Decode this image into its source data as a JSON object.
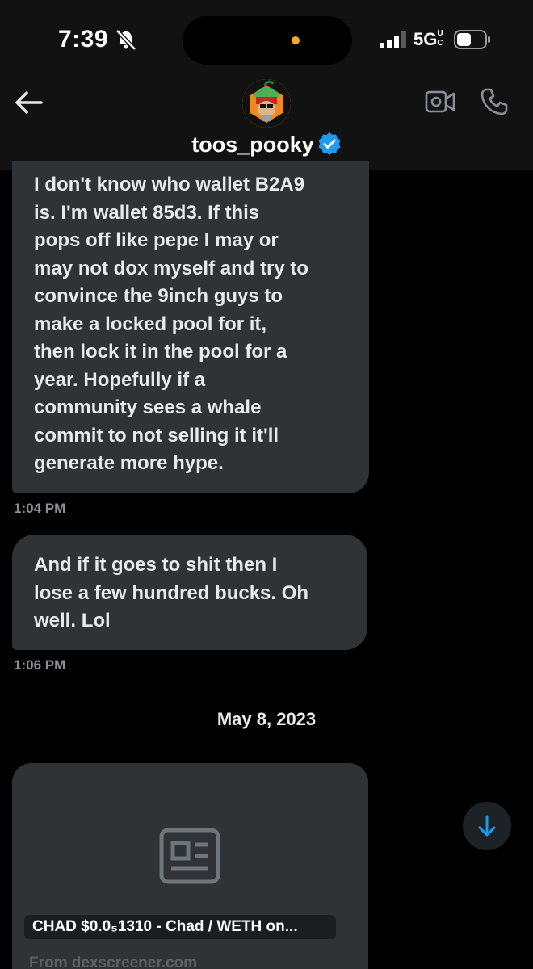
{
  "status_bar": {
    "time": "7:39",
    "bell_icon": "bell-slash-icon",
    "network": "5G",
    "network_suffix": "UC",
    "orange_indicator_color": "#f5a623"
  },
  "header": {
    "back_icon": "arrow-left-icon",
    "username": "toos_pooky",
    "verified_icon": "verified-badge-icon",
    "video_icon": "video-camera-icon",
    "phone_icon": "phone-icon",
    "avatar_color": "#f08a1d"
  },
  "messages": [
    {
      "text": "I don't know who wallet B2A9\nis. I'm wallet 85d3. If this\npops off like pepe I may or\nmay not dox myself and try to\nconvince the 9inch guys to\nmake a locked pool for it,\nthen lock it in the pool for a\nyear. Hopefully if a\ncommunity sees a whale\ncommit to not selling it it'll\ngenerate more hype.",
      "time": "1:04 PM"
    },
    {
      "text": "And if it goes to shit then I\nlose a few hundred bucks. Oh\nwell. Lol",
      "time": "1:06 PM"
    }
  ],
  "date_divider": "May 8, 2023",
  "link_card": {
    "placeholder_icon": "newspaper-icon",
    "title": "CHAD $0.0₅1310 - Chad / WETH on...",
    "domain": "From dexscreener.com"
  },
  "scroll_button": {
    "icon": "arrow-down-icon",
    "color": "#1d9bf0"
  }
}
